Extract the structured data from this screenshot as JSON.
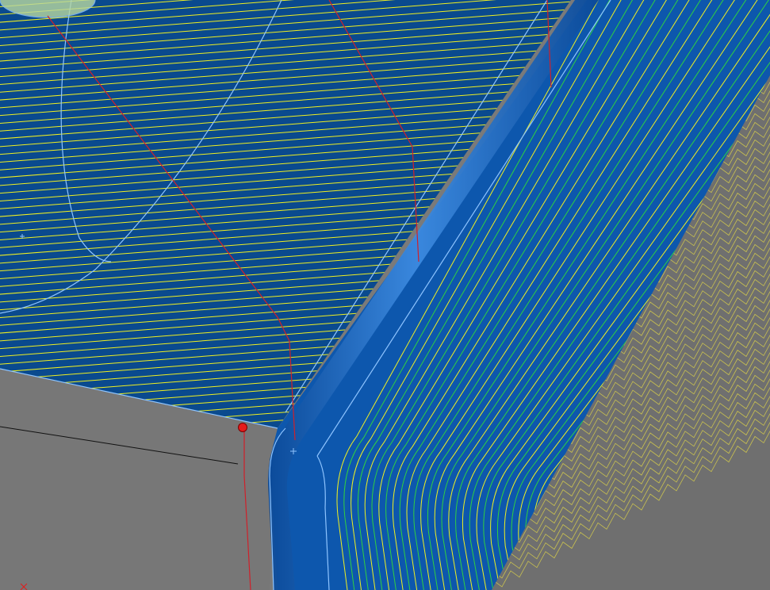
{
  "viewport": {
    "background_color": "#7a7a7a",
    "top_face_color": "#0a4a8e",
    "wall_face_color": "#0d57ad",
    "fillet_color": "#1464c8",
    "toolpath_color": "#f0f020",
    "inner_toolpath_color": "#30d040",
    "edge_color": "#8ec4ff",
    "feed_path_color": "#d0202a",
    "start_point_color": "#e41b1b",
    "wall_hatch_color": "#c8c050"
  },
  "markers": {
    "start_point_icon": "red-dot",
    "origin_icon": "axis-triad"
  }
}
